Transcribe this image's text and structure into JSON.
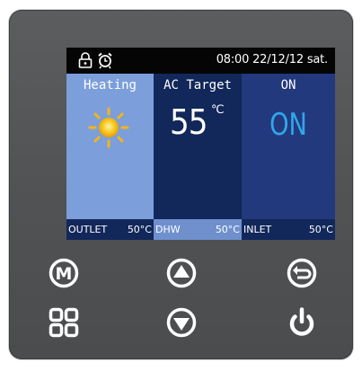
{
  "status_bar": {
    "datetime": "08:00 22/12/12 sat.",
    "icons": [
      "lock-icon",
      "alarm-clock-icon"
    ]
  },
  "mode_column": {
    "title": "Heating",
    "icon": "sun-icon",
    "color": "#7c9fdb"
  },
  "ac_column": {
    "title": "AC Target",
    "value": "55",
    "unit": "℃",
    "color": "#12275a"
  },
  "on_column": {
    "title": "ON",
    "value": "ON",
    "value_color": "#31a7ea",
    "color": "#22397d"
  },
  "bottom_bar": {
    "outlet": {
      "label": "OUTLET",
      "value": "50°C"
    },
    "dhw": {
      "label": "DHW",
      "value": "50°C"
    },
    "inlet": {
      "label": "INLET",
      "value": "50°C"
    }
  },
  "buttons": {
    "mode": {
      "icon": "m-circle-icon",
      "glyph": "M"
    },
    "up": {
      "icon": "up-arrow-circle-icon"
    },
    "back": {
      "icon": "return-circle-icon"
    },
    "menu": {
      "icon": "grid-menu-icon"
    },
    "down": {
      "icon": "down-arrow-circle-icon"
    },
    "power": {
      "icon": "power-icon"
    }
  }
}
